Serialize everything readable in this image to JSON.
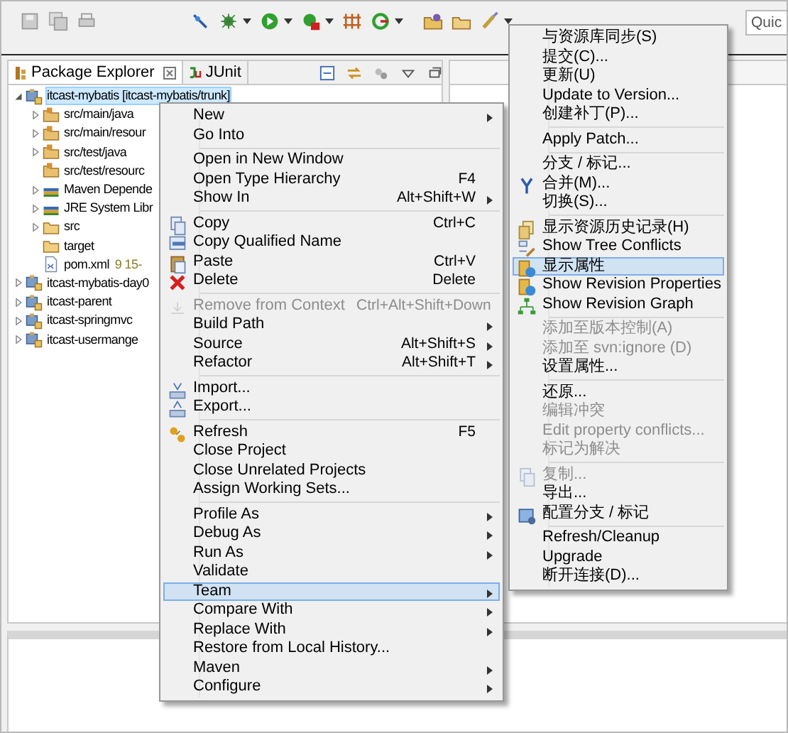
{
  "toolbar": {
    "quick_access": {
      "placeholder": "Quic"
    }
  },
  "package_explorer": {
    "tabs": [
      {
        "label": "Package Explorer",
        "selected": true
      },
      {
        "label": "JUnit",
        "selected": false
      }
    ],
    "tree": [
      {
        "label": "itcast-mybatis [itcast-mybatis/trunk]",
        "kind": "project",
        "expanded": true,
        "selected": true,
        "children": [
          {
            "label": "src/main/java",
            "kind": "package",
            "expanded": false,
            "selected": false
          },
          {
            "label": "src/main/resour",
            "kind": "package",
            "expanded": false,
            "selected": false
          },
          {
            "label": "src/test/java",
            "kind": "package",
            "expanded": false,
            "selected": false
          },
          {
            "label": "src/test/resourc",
            "kind": "package",
            "selected": false
          },
          {
            "label": "Maven Depende",
            "kind": "library",
            "expanded": false,
            "selected": false
          },
          {
            "label": "JRE System Libr",
            "kind": "library",
            "expanded": false,
            "selected": false
          },
          {
            "label": "src",
            "kind": "folder",
            "expanded": false,
            "selected": false
          },
          {
            "label": "target",
            "kind": "folder",
            "selected": false
          },
          {
            "label": "pom.xml",
            "decoration": "9  15-",
            "kind": "file",
            "selected": false
          }
        ]
      },
      {
        "label": "itcast-mybatis-day0",
        "kind": "project",
        "expanded": false,
        "selected": false
      },
      {
        "label": "itcast-parent",
        "kind": "project",
        "expanded": false,
        "selected": false
      },
      {
        "label": "itcast-springmvc",
        "kind": "project",
        "expanded": false,
        "selected": false
      },
      {
        "label": "itcast-usermange",
        "kind": "project",
        "expanded": false,
        "selected": false
      }
    ]
  },
  "context_menu": {
    "items": [
      {
        "kind": "item",
        "label": "New",
        "submenu": true,
        "disabled": false,
        "selected": false
      },
      {
        "kind": "item",
        "label": "Go Into",
        "submenu": false,
        "disabled": false,
        "selected": false
      },
      {
        "kind": "separator"
      },
      {
        "kind": "item",
        "label": "Open in New Window",
        "submenu": false,
        "disabled": false,
        "selected": false
      },
      {
        "kind": "item",
        "label": "Open Type Hierarchy",
        "shortcut": "F4",
        "submenu": false,
        "disabled": false,
        "selected": false
      },
      {
        "kind": "item",
        "label": "Show In",
        "shortcut": "Alt+Shift+W",
        "submenu": true,
        "disabled": false,
        "selected": false
      },
      {
        "kind": "separator"
      },
      {
        "kind": "copy",
        "label": "Copy",
        "shortcut": "Ctrl+C",
        "submenu": false,
        "disabled": false,
        "selected": false
      },
      {
        "kind": "clipboard",
        "label": "Copy Qualified Name",
        "submenu": false,
        "disabled": false,
        "selected": false
      },
      {
        "kind": "paste",
        "label": "Paste",
        "shortcut": "Ctrl+V",
        "submenu": false,
        "disabled": false,
        "selected": false
      },
      {
        "kind": "delete",
        "label": "Delete",
        "shortcut": "Delete",
        "submenu": false,
        "disabled": false,
        "selected": false
      },
      {
        "kind": "separator"
      },
      {
        "kind": "remove",
        "label": "Remove from Context",
        "shortcut": "Ctrl+Alt+Shift+Down",
        "submenu": false,
        "disabled": true,
        "selected": false
      },
      {
        "kind": "item",
        "label": "Build Path",
        "submenu": true,
        "disabled": false,
        "selected": false
      },
      {
        "kind": "item",
        "label": "Source",
        "shortcut": "Alt+Shift+S",
        "submenu": true,
        "disabled": false,
        "selected": false
      },
      {
        "kind": "item",
        "label": "Refactor",
        "shortcut": "Alt+Shift+T",
        "submenu": true,
        "disabled": false,
        "selected": false
      },
      {
        "kind": "separator"
      },
      {
        "kind": "import",
        "label": "Import...",
        "submenu": false,
        "disabled": false,
        "selected": false
      },
      {
        "kind": "export",
        "label": "Export...",
        "submenu": false,
        "disabled": false,
        "selected": false
      },
      {
        "kind": "separator"
      },
      {
        "kind": "refresh",
        "label": "Refresh",
        "shortcut": "F5",
        "submenu": false,
        "disabled": false,
        "selected": false
      },
      {
        "kind": "item",
        "label": "Close Project",
        "submenu": false,
        "disabled": false,
        "selected": false
      },
      {
        "kind": "item",
        "label": "Close Unrelated Projects",
        "submenu": false,
        "disabled": false,
        "selected": false
      },
      {
        "kind": "item",
        "label": "Assign Working Sets...",
        "submenu": false,
        "disabled": false,
        "selected": false
      },
      {
        "kind": "separator"
      },
      {
        "kind": "item",
        "label": "Profile As",
        "submenu": true,
        "disabled": false,
        "selected": false
      },
      {
        "kind": "item",
        "label": "Debug As",
        "submenu": true,
        "disabled": false,
        "selected": false
      },
      {
        "kind": "item",
        "label": "Run As",
        "submenu": true,
        "disabled": false,
        "selected": false
      },
      {
        "kind": "item",
        "label": "Validate",
        "submenu": false,
        "disabled": false,
        "selected": false
      },
      {
        "kind": "item",
        "label": "Team",
        "submenu": true,
        "disabled": false,
        "selected": true
      },
      {
        "kind": "item",
        "label": "Compare With",
        "submenu": true,
        "disabled": false,
        "selected": false
      },
      {
        "kind": "item",
        "label": "Replace With",
        "submenu": true,
        "disabled": false,
        "selected": false
      },
      {
        "kind": "item",
        "label": "Restore from Local History...",
        "submenu": false,
        "disabled": false,
        "selected": false
      },
      {
        "kind": "item",
        "label": "Maven",
        "submenu": true,
        "disabled": false,
        "selected": false
      },
      {
        "kind": "item",
        "label": "Configure",
        "submenu": true,
        "disabled": false,
        "selected": false
      }
    ]
  },
  "team_menu": {
    "items": [
      {
        "kind": "item",
        "label": "与资源库同步(S)",
        "submenu": false,
        "disabled": false,
        "selected": false
      },
      {
        "kind": "item",
        "label": "提交(C)...",
        "submenu": false,
        "disabled": false,
        "selected": false
      },
      {
        "kind": "item",
        "label": "更新(U)",
        "submenu": false,
        "disabled": false,
        "selected": false
      },
      {
        "kind": "item",
        "label": "Update to Version...",
        "submenu": false,
        "disabled": false,
        "selected": false
      },
      {
        "kind": "item",
        "label": "创建补丁(P)...",
        "submenu": false,
        "disabled": false,
        "selected": false
      },
      {
        "kind": "separator"
      },
      {
        "kind": "item",
        "label": "Apply Patch...",
        "submenu": false,
        "disabled": false,
        "selected": false
      },
      {
        "kind": "separator"
      },
      {
        "kind": "item",
        "label": "分支 / 标记...",
        "submenu": false,
        "disabled": false,
        "selected": false
      },
      {
        "kind": "merge",
        "label": "合并(M)...",
        "submenu": false,
        "disabled": false,
        "selected": false
      },
      {
        "kind": "item",
        "label": "切换(S)...",
        "submenu": false,
        "disabled": false,
        "selected": false
      },
      {
        "kind": "separator"
      },
      {
        "kind": "history",
        "label": "显示资源历史记录(H)",
        "submenu": false,
        "disabled": false,
        "selected": false
      },
      {
        "kind": "conflicts",
        "label": "Show Tree Conflicts",
        "submenu": false,
        "disabled": false,
        "selected": false
      },
      {
        "kind": "properties",
        "label": "显示属性",
        "submenu": false,
        "disabled": false,
        "selected": true
      },
      {
        "kind": "properties",
        "label": "Show Revision Properties",
        "submenu": false,
        "disabled": false,
        "selected": false
      },
      {
        "kind": "graph",
        "label": "Show Revision Graph",
        "submenu": false,
        "disabled": false,
        "selected": false
      },
      {
        "kind": "separator"
      },
      {
        "kind": "item",
        "label": "添加至版本控制(A)",
        "submenu": false,
        "disabled": true,
        "selected": false
      },
      {
        "kind": "item",
        "label": "添加至 svn:ignore (D)",
        "submenu": false,
        "disabled": true,
        "selected": false
      },
      {
        "kind": "item",
        "label": "设置属性...",
        "submenu": false,
        "disabled": false,
        "selected": false
      },
      {
        "kind": "separator"
      },
      {
        "kind": "item",
        "label": "还原...",
        "submenu": false,
        "disabled": false,
        "selected": false
      },
      {
        "kind": "item",
        "label": "编辑冲突",
        "submenu": false,
        "disabled": true,
        "selected": false
      },
      {
        "kind": "item",
        "label": "Edit property conflicts...",
        "submenu": false,
        "disabled": true,
        "selected": false
      },
      {
        "kind": "item",
        "label": "标记为解决",
        "submenu": false,
        "disabled": true,
        "selected": false
      },
      {
        "kind": "separator"
      },
      {
        "kind": "copy",
        "label": "复制...",
        "submenu": false,
        "disabled": true,
        "selected": false
      },
      {
        "kind": "item",
        "label": "导出...",
        "submenu": false,
        "disabled": false,
        "selected": false
      },
      {
        "kind": "branches",
        "label": "配置分支 / 标记",
        "submenu": false,
        "disabled": false,
        "selected": false
      },
      {
        "kind": "separator"
      },
      {
        "kind": "item",
        "label": "Refresh/Cleanup",
        "submenu": false,
        "disabled": false,
        "selected": false
      },
      {
        "kind": "item",
        "label": "Upgrade",
        "submenu": false,
        "disabled": false,
        "selected": false
      },
      {
        "kind": "item",
        "label": "断开连接(D)...",
        "submenu": false,
        "disabled": false,
        "selected": false
      }
    ]
  }
}
